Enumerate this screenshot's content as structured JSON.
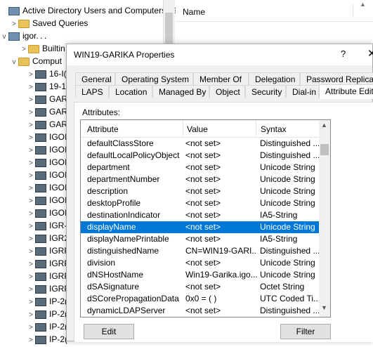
{
  "mmc": {
    "tree": [
      {
        "label": "Active Directory Users and Computers [G",
        "icon": "aduc-icon",
        "expander": ""
      },
      {
        "label": "Saved Queries",
        "icon": "folder-icon",
        "expander": ">"
      },
      {
        "label": "igor. . .",
        "icon": "domain-icon",
        "expander": "v"
      },
      {
        "label": "Builtin",
        "icon": "folder-icon",
        "expander": ">"
      },
      {
        "label": "Comput",
        "icon": "folder-icon",
        "expander": "v"
      },
      {
        "label": "16-I(",
        "icon": "computer-icon",
        "expander": ">"
      },
      {
        "label": "19-1",
        "icon": "computer-icon",
        "expander": ">"
      },
      {
        "label": "GAR",
        "icon": "computer-icon",
        "expander": ">"
      },
      {
        "label": "GAR",
        "icon": "computer-icon",
        "expander": ">"
      },
      {
        "label": "GAR",
        "icon": "computer-icon",
        "expander": ">"
      },
      {
        "label": "IGOI",
        "icon": "computer-icon",
        "expander": ">"
      },
      {
        "label": "IGOI",
        "icon": "computer-icon",
        "expander": ">"
      },
      {
        "label": "IGOI",
        "icon": "computer-icon",
        "expander": ">"
      },
      {
        "label": "IGOI",
        "icon": "computer-icon",
        "expander": ">"
      },
      {
        "label": "IGOI",
        "icon": "computer-icon",
        "expander": ">"
      },
      {
        "label": "IGOI",
        "icon": "computer-icon",
        "expander": ">"
      },
      {
        "label": "IGOI",
        "icon": "computer-icon",
        "expander": ">"
      },
      {
        "label": "IGR-",
        "icon": "computer-icon",
        "expander": ">"
      },
      {
        "label": "IGR2",
        "icon": "computer-icon",
        "expander": ">"
      },
      {
        "label": "IGRP",
        "icon": "computer-icon",
        "expander": ">"
      },
      {
        "label": "IGRP",
        "icon": "computer-icon",
        "expander": ">"
      },
      {
        "label": "IGRP",
        "icon": "computer-icon",
        "expander": ">"
      },
      {
        "label": "IGRP",
        "icon": "computer-icon",
        "expander": ">"
      },
      {
        "label": "IP-2(",
        "icon": "computer-icon",
        "expander": ">"
      },
      {
        "label": "IP-2(",
        "icon": "computer-icon",
        "expander": ">"
      },
      {
        "label": "IP-2(",
        "icon": "computer-icon",
        "expander": ">"
      },
      {
        "label": "IP-2(",
        "icon": "computer-icon",
        "expander": ">"
      }
    ],
    "list_header": "Name"
  },
  "dialog": {
    "title": "WIN19-GARIKA Properties",
    "help": "?",
    "close": "✕",
    "tabs_back": [
      "General",
      "Operating System",
      "Member Of",
      "Delegation",
      "Password Replication"
    ],
    "tabs_front": [
      "LAPS",
      "Location",
      "Managed By",
      "Object",
      "Security",
      "Dial-in",
      "Attribute Editor"
    ],
    "active_tab": "Attribute Editor",
    "attributes_label": "Attributes:",
    "columns": [
      "Attribute",
      "Value",
      "Syntax"
    ],
    "rows": [
      {
        "attribute": "defaultClassStore",
        "value": "<not set>",
        "syntax": "Distinguished ..."
      },
      {
        "attribute": "defaultLocalPolicyObject",
        "value": "<not set>",
        "syntax": "Distinguished ..."
      },
      {
        "attribute": "department",
        "value": "<not set>",
        "syntax": "Unicode String"
      },
      {
        "attribute": "departmentNumber",
        "value": "<not set>",
        "syntax": "Unicode String"
      },
      {
        "attribute": "description",
        "value": "<not set>",
        "syntax": "Unicode String"
      },
      {
        "attribute": "desktopProfile",
        "value": "<not set>",
        "syntax": "Unicode String"
      },
      {
        "attribute": "destinationIndicator",
        "value": "<not set>",
        "syntax": "IA5-String"
      },
      {
        "attribute": "displayName",
        "value": "<not set>",
        "syntax": "Unicode String",
        "selected": true
      },
      {
        "attribute": "displayNamePrintable",
        "value": "<not set>",
        "syntax": "IA5-String"
      },
      {
        "attribute": "distinguishedName",
        "value": "CN=WIN19-GARI...",
        "syntax": "Distinguished ..."
      },
      {
        "attribute": "division",
        "value": "<not set>",
        "syntax": "Unicode String"
      },
      {
        "attribute": "dNSHostName",
        "value": "Win19-Garika.igo...",
        "syntax": "Unicode String"
      },
      {
        "attribute": "dSASignature",
        "value": "<not set>",
        "syntax": "Octet String"
      },
      {
        "attribute": "dSCorePropagationData",
        "value": "0x0 = ( )",
        "syntax": "UTC Coded Ti..."
      },
      {
        "attribute": "dynamicLDAPServer",
        "value": "<not set>",
        "syntax": "Distinguished ..."
      }
    ],
    "edit_label": "Edit",
    "filter_label": "Filter"
  }
}
